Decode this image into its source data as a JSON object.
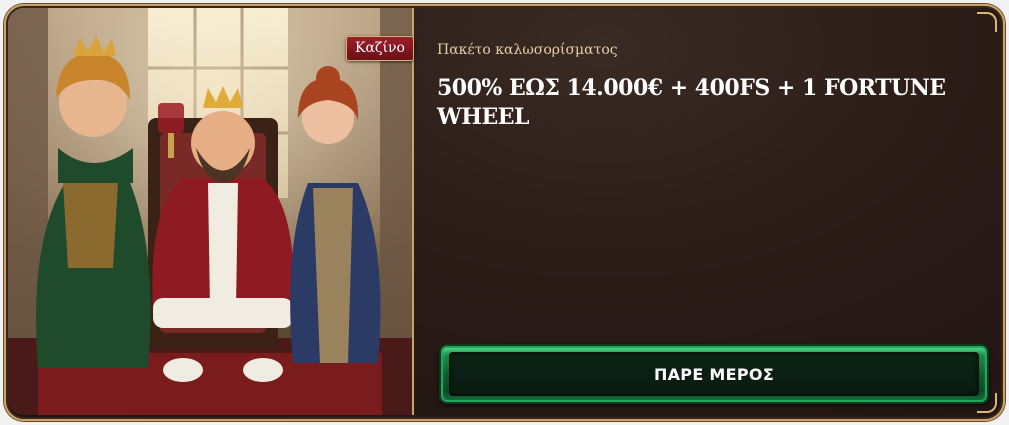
{
  "badge": {
    "label": "Καζίνο"
  },
  "offer": {
    "subtitle": "Πακέτο καλωσορίσματος",
    "headline": "500% ΕΩΣ 14.000€ + 400FS + 1 FORTUNE WHEEL"
  },
  "cta": {
    "label": "ΠΑΡΕ ΜΕΡΟΣ"
  },
  "colors": {
    "frame_gold": "#c9a46a",
    "badge_red": "#9b1f2a",
    "button_green": "#17894a",
    "panel_dark": "#2a1b17"
  },
  "art": {
    "characters": [
      "queen-left",
      "king-center",
      "princess-right"
    ]
  }
}
